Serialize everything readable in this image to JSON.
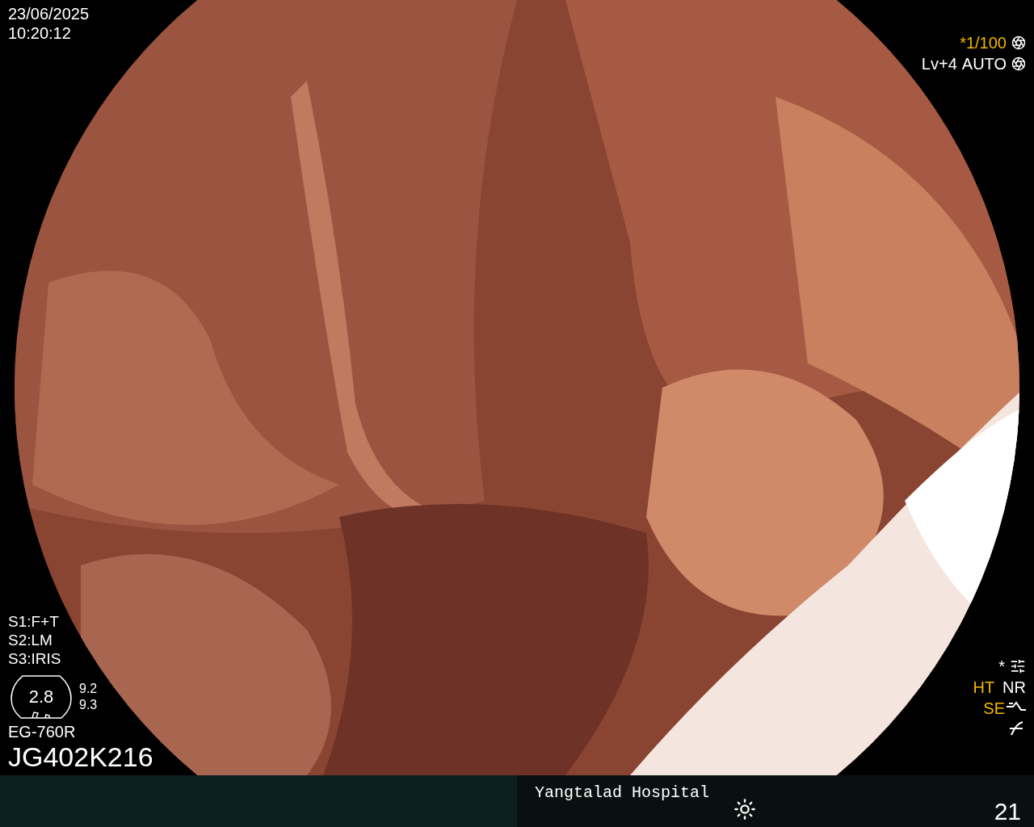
{
  "top_left": {
    "date": "23/06/2025",
    "time": "10:20:12"
  },
  "top_right": {
    "shutter": {
      "text": "*1/100",
      "highlighted": true
    },
    "brightness": {
      "level_text": "Lv+4",
      "mode": "AUTO"
    }
  },
  "scope_buttons": [
    {
      "label": "S1:F+T"
    },
    {
      "label": "S2:LM"
    },
    {
      "label": "S3:IRIS"
    }
  ],
  "gauge": {
    "value": "2.8",
    "readings": [
      "9.2",
      "9.3"
    ]
  },
  "scope": {
    "model": "EG-760R",
    "serial": "JG402K216"
  },
  "settings_mark": "*",
  "indicators": [
    {
      "label": "HT",
      "active": true
    },
    {
      "label": "NR",
      "active": false
    },
    {
      "label": "SE",
      "active": true
    }
  ],
  "footer": {
    "hospital": "Yangtalad Hospital",
    "number": "21"
  }
}
